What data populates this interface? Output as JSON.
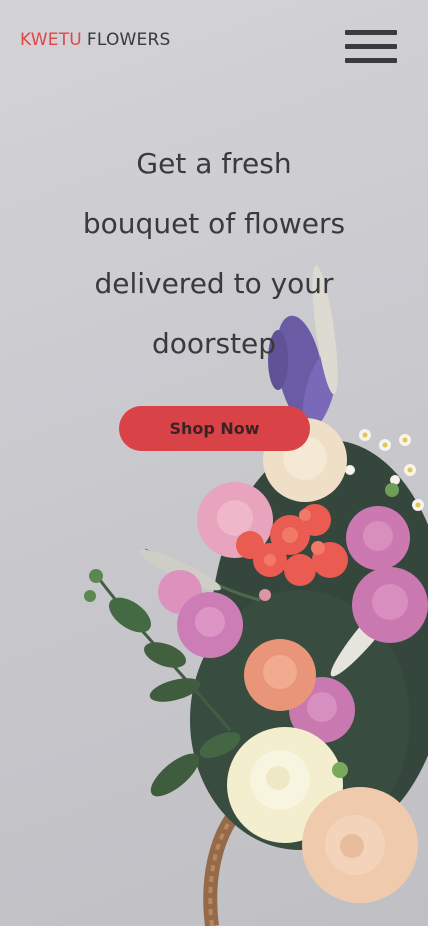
{
  "brand": {
    "part1": "KWETU",
    "part2": "FLOWERS"
  },
  "header": {
    "menu_icon": "hamburger-menu-icon"
  },
  "hero": {
    "headline_line1": "Get a fresh",
    "headline_line2": "bouquet of flowers",
    "headline_line3": "delivered to your",
    "headline_line4": "doorstep",
    "cta_label": "Shop Now"
  },
  "colors": {
    "accent": "#e0454b",
    "button": "#d94347",
    "text": "#3a3a3d",
    "background": "#c8c8cc"
  }
}
